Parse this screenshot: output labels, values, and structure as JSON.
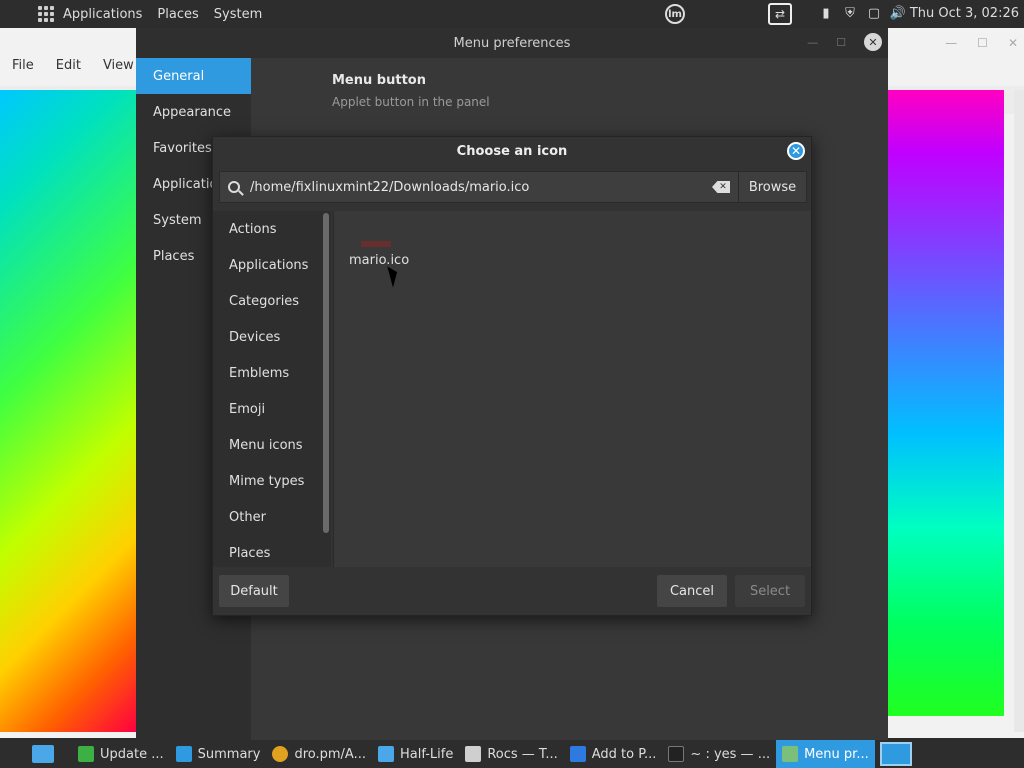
{
  "top_panel": {
    "menus": [
      "Applications",
      "Places",
      "System"
    ],
    "mint_logo": "lm",
    "icons": [
      "apps-grid-icon",
      "mint-logo-icon",
      "display-switch-icon",
      "clipboard-icon",
      "shield-icon",
      "battery-icon",
      "volume-icon"
    ],
    "clock": "Thu Oct  3, 02:26"
  },
  "file_manager": {
    "menubar": [
      "File",
      "Edit",
      "View"
    ]
  },
  "prefs": {
    "title": "Menu preferences",
    "sidebar": [
      "General",
      "Appearance",
      "Favorites",
      "Applications",
      "System",
      "Places"
    ],
    "active_sidebar": "General",
    "section_title": "Menu button",
    "section_subtitle": "Applet button in the panel",
    "accent_color": "#2f9ae0"
  },
  "chooser": {
    "title": "Choose an icon",
    "path": "/home/fixlinuxmint22/Downloads/mario.ico",
    "browse_label": "Browse",
    "categories": [
      "Actions",
      "Applications",
      "Categories",
      "Devices",
      "Emblems",
      "Emoji",
      "Menu icons",
      "Mime types",
      "Other",
      "Places"
    ],
    "icons": [
      {
        "label": "mario.ico"
      }
    ],
    "default_label": "Default",
    "cancel_label": "Cancel",
    "select_label": "Select"
  },
  "taskbar": {
    "tasks": [
      {
        "label": "Update ...",
        "color": "#3cb043"
      },
      {
        "label": "Summary",
        "color": "#2f9ae0"
      },
      {
        "label": "dro.pm/A...",
        "color": "#e0a020"
      },
      {
        "label": "Half-Life",
        "color": "#4aa8e8"
      },
      {
        "label": "Rocs — T...",
        "color": "#cfcfcf"
      },
      {
        "label": "Add to P...",
        "color": "#2f7ae0"
      },
      {
        "label": "~ : yes — ...",
        "color": "#222222"
      },
      {
        "label": "Menu pr...",
        "color": "#7ac07a",
        "active": true
      }
    ]
  }
}
